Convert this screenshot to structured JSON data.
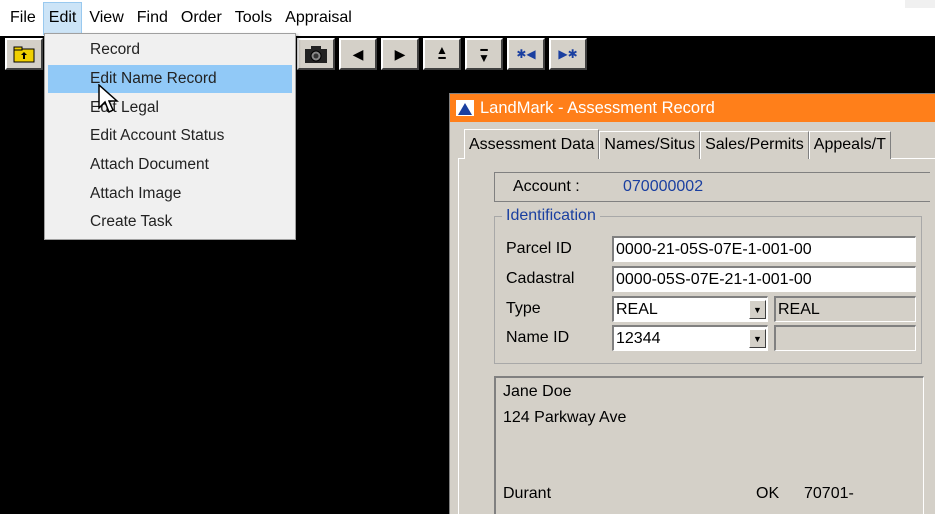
{
  "menubar": {
    "items": [
      "File",
      "Edit",
      "View",
      "Find",
      "Order",
      "Tools",
      "Appraisal"
    ],
    "active": "Edit"
  },
  "edit_menu": {
    "items": [
      "Record",
      "Edit Name Record",
      "Edit Legal",
      "Edit Account Status",
      "Attach Document",
      "Attach Image",
      "Create Task"
    ],
    "hovered": "Edit Name Record"
  },
  "toolbar": {
    "icons": [
      "folder-up-icon",
      "camera-icon",
      "previous-icon",
      "next-icon",
      "first-icon",
      "last-icon",
      "prev-page-icon",
      "next-page-icon"
    ]
  },
  "window": {
    "title": "LandMark - Assessment Record",
    "title_color": "#ff7f1a",
    "tabs": [
      "Assessment Data",
      "Names/Situs",
      "Sales/Permits",
      "Appeals/T"
    ],
    "account": {
      "label": "Account :",
      "value": "070000002"
    },
    "identification": {
      "legend": "Identification",
      "parcel_id": {
        "label": "Parcel ID",
        "value": "0000-21-05S-07E-1-001-00"
      },
      "cadastral": {
        "label": "Cadastral",
        "value": "0000-05S-07E-21-1-001-00"
      },
      "type": {
        "label": "Type",
        "value": "REAL",
        "description": "REAL"
      },
      "name_id": {
        "label": "Name ID",
        "value": "12344",
        "description": ""
      }
    },
    "address": {
      "name": "Jane Doe",
      "street": "124 Parkway Ave",
      "city": "Durant",
      "state": "OK",
      "zip": "70701-"
    }
  }
}
